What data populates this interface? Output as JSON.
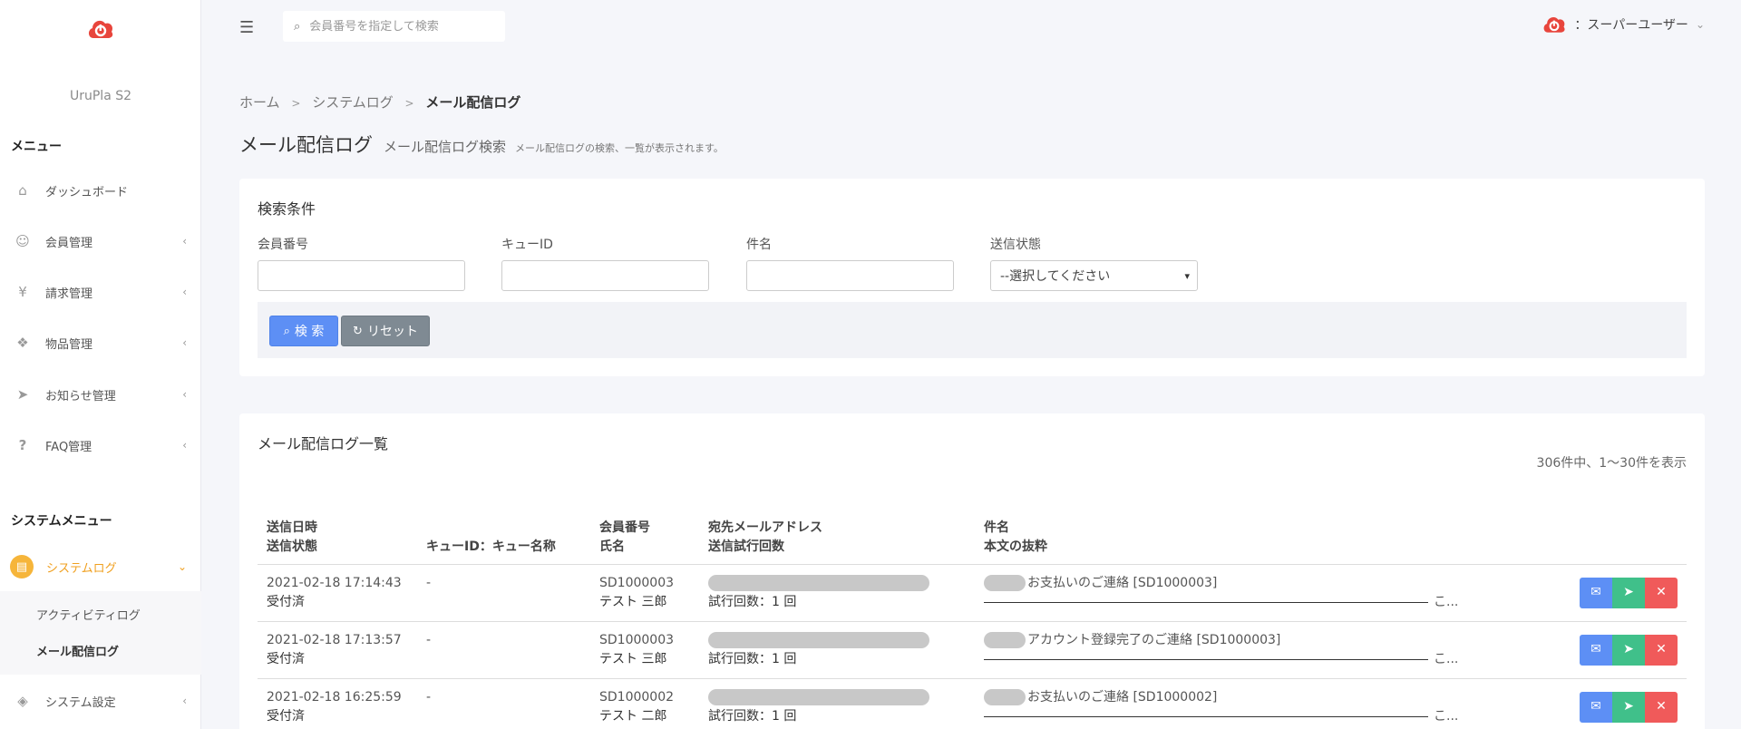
{
  "brand": "UruPla S2",
  "menu_heading": "メニュー",
  "system_menu_heading": "システムメニュー",
  "sidebar": {
    "items": [
      {
        "label": "ダッシュボード",
        "icon": "home-icon"
      },
      {
        "label": "会員管理",
        "icon": "user-icon"
      },
      {
        "label": "請求管理",
        "icon": "yen-icon"
      },
      {
        "label": "物品管理",
        "icon": "boxes-icon"
      },
      {
        "label": "お知らせ管理",
        "icon": "paper-plane-icon"
      },
      {
        "label": "FAQ管理",
        "icon": "question-icon"
      }
    ],
    "system_items": [
      {
        "label": "システムログ",
        "icon": "document-icon"
      },
      {
        "label": "システム設定",
        "icon": "layers-icon"
      }
    ],
    "sub_items": [
      "アクティビティログ",
      "メール配信ログ"
    ]
  },
  "topbar": {
    "search_placeholder": "会員番号を指定して検索",
    "user_label": "：スーパーユーザー"
  },
  "breadcrumb": {
    "home": "ホーム",
    "sep": ">",
    "level1": "システムログ",
    "current": "メール配信ログ"
  },
  "page": {
    "title": "メール配信ログ",
    "subtitle": "メール配信ログ検索",
    "description": "メール配信ログの検索、一覧が表示されます。"
  },
  "search": {
    "heading": "検索条件",
    "fields": {
      "member_no": "会員番号",
      "queue_id": "キューID",
      "subject": "件名",
      "status": "送信状態"
    },
    "status_selected": "--選択してください",
    "search_button": "検 索",
    "reset_button": "リセット"
  },
  "list": {
    "heading": "メール配信ログ一覧",
    "count_text": "306件中、1〜30件を表示",
    "headers": {
      "col1a": "送信日時",
      "col1b": "送信状態",
      "col2": "キューID：キュー名称",
      "col3a": "会員番号",
      "col3b": "氏名",
      "col4a": "宛先メールアドレス",
      "col4b": "送信試行回数",
      "col5a": "件名",
      "col5b": "本文の抜粋"
    },
    "rows": [
      {
        "datetime": "2021-02-18 17:14:43",
        "status": "受付済",
        "queue": "-",
        "member_no": "SD1000003",
        "name": "テスト 三郎",
        "tries": "試行回数：1 回",
        "subject": "お支払いのご連絡 [SD1000003]",
        "excerpt_tail": "こ..."
      },
      {
        "datetime": "2021-02-18 17:13:57",
        "status": "受付済",
        "queue": "-",
        "member_no": "SD1000003",
        "name": "テスト 三郎",
        "tries": "試行回数：1 回",
        "subject": "アカウント登録完了のご連絡 [SD1000003]",
        "excerpt_tail": "こ..."
      },
      {
        "datetime": "2021-02-18 16:25:59",
        "status": "受付済",
        "queue": "-",
        "member_no": "SD1000002",
        "name": "テスト 二郎",
        "tries": "試行回数：1 回",
        "subject": "お支払いのご連絡 [SD1000002]",
        "excerpt_tail": "こ..."
      }
    ]
  },
  "colors": {
    "brand_red": "#e8453c",
    "active_orange": "#f0a020",
    "btn_primary": "#5d8ff5",
    "btn_secondary": "#7f8a93",
    "act_send": "#40c08a",
    "act_delete": "#f05a5a"
  }
}
